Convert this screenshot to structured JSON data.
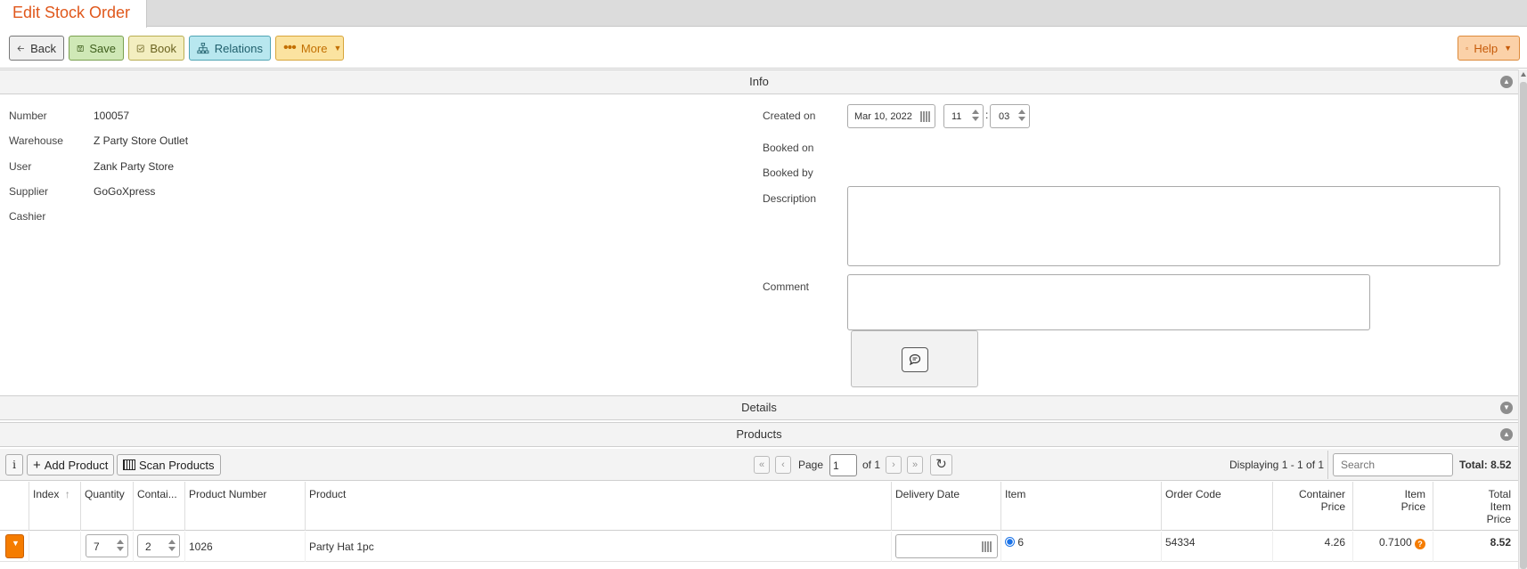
{
  "window": {
    "title": "Edit Stock Order"
  },
  "toolbar": {
    "back": "Back",
    "save": "Save",
    "book": "Book",
    "relations": "Relations",
    "more": "More",
    "help": "Help"
  },
  "sections": {
    "info": "Info",
    "details": "Details",
    "products": "Products"
  },
  "info": {
    "number_label": "Number",
    "number_value": "100057",
    "warehouse_label": "Warehouse",
    "warehouse_value": "Z Party Store Outlet",
    "user_label": "User",
    "user_value": "Zank Party Store",
    "supplier_label": "Supplier",
    "supplier_value": "GoGoXpress",
    "cashier_label": "Cashier",
    "cashier_value": "",
    "created_label": "Created on",
    "created_date": "Mar 10, 2022",
    "created_hour": "11",
    "created_minute": "03",
    "booked_on_label": "Booked on",
    "booked_by_label": "Booked by",
    "description_label": "Description",
    "description_value": "",
    "comment_label": "Comment",
    "comment_value": ""
  },
  "products_toolbar": {
    "add_product": "Add Product",
    "scan_products": "Scan Products",
    "page_label": "Page",
    "page_value": "1",
    "of_label": "of 1",
    "displaying": "Displaying 1 - 1 of 1",
    "search_placeholder": "Search",
    "total": "Total: 8.52"
  },
  "grid": {
    "columns": [
      "Index",
      "Quantity",
      "Contai...",
      "Product Number",
      "Product",
      "Delivery Date",
      "Item",
      "Order Code",
      "Container\nPrice",
      "Item\nPrice",
      "Total\nItem\nPrice"
    ],
    "rows": [
      {
        "index": "",
        "quantity": "7",
        "container": "2",
        "product_number": "1026",
        "product": "Party Hat 1pc",
        "delivery_date": "",
        "item": "6",
        "order_code": "54334",
        "container_price": "4.26",
        "item_price": "0.7100",
        "total": "8.52"
      }
    ]
  },
  "colors": {
    "accent": "#e0581c",
    "row_menu": "#f57c00"
  }
}
